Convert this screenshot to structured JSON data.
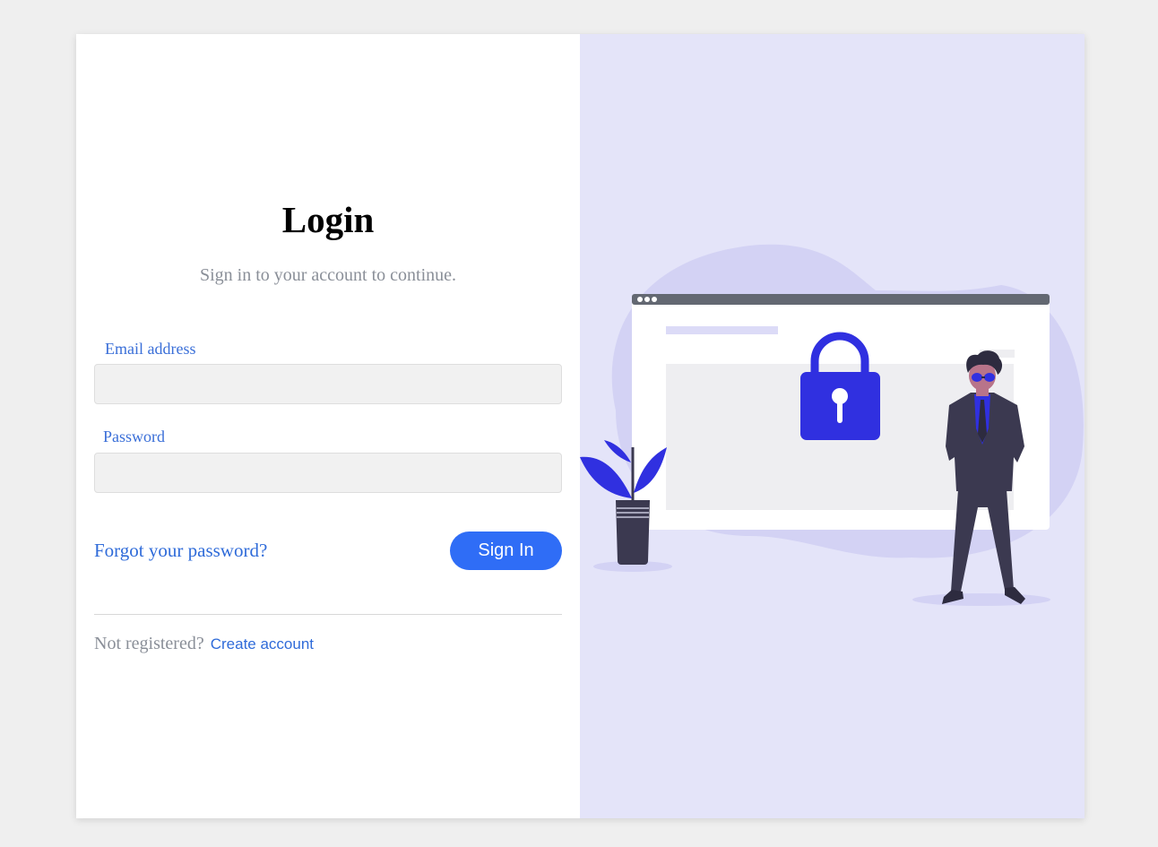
{
  "login": {
    "title": "Login",
    "subtitle": "Sign in to your account to continue.",
    "email_label": "Email address",
    "email_value": "",
    "password_label": "Password",
    "password_value": "",
    "forgot_link": "Forgot your password?",
    "signin_button": "Sign In",
    "not_registered": "Not registered?",
    "create_account_link": "Create account"
  },
  "colors": {
    "accent": "#2f6df6",
    "link": "#2f6bd9",
    "illustration_bg": "#e4e4f9",
    "illustration_accent": "#3030e0"
  },
  "icons": {
    "illustration": "lock-browser-security-illustration"
  }
}
